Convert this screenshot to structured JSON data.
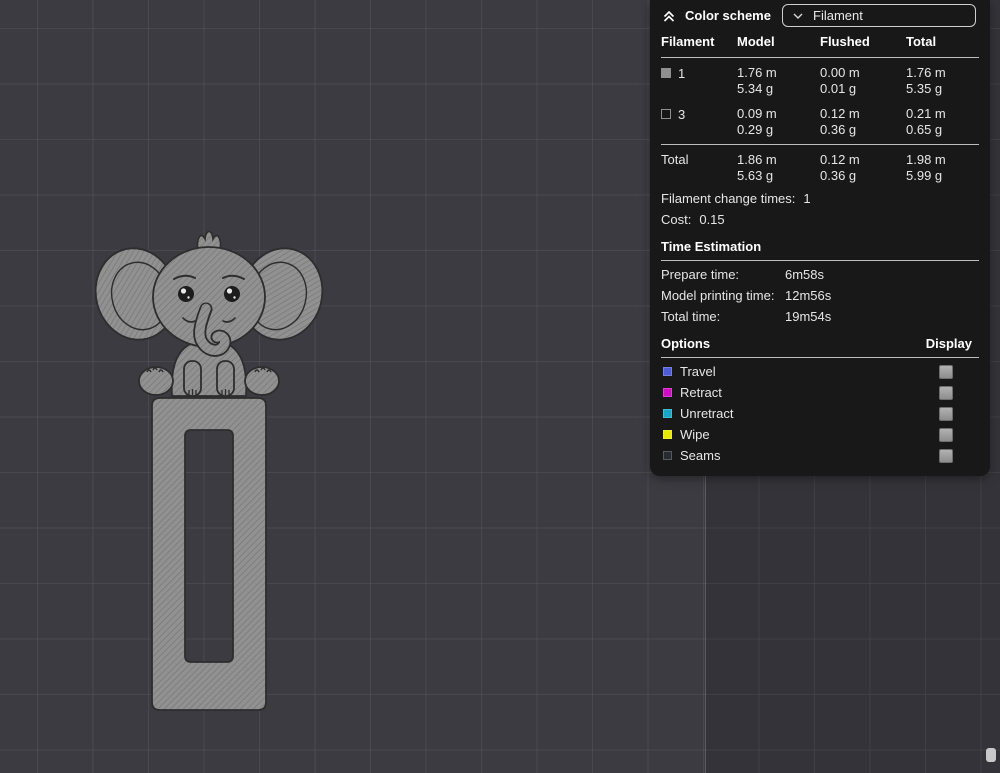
{
  "scene": {
    "bg": "#3b3b41",
    "plate_edge": "#5f5f66"
  },
  "model": {
    "name": "elephant bookmark",
    "fill": "#919191",
    "hatch": "#767676",
    "outline": "#2d2d2d"
  },
  "panel": {
    "title": "Color scheme",
    "dropdown": {
      "value": "Filament"
    },
    "table": {
      "headers": {
        "filament": "Filament",
        "model": "Model",
        "flushed": "Flushed",
        "total": "Total"
      },
      "rows": [
        {
          "id": "1",
          "color": "#8f8f8f",
          "model_len": "1.76 m",
          "model_wt": "5.34 g",
          "flushed_len": "0.00 m",
          "flushed_wt": "0.01 g",
          "total_len": "1.76 m",
          "total_wt": "5.35 g"
        },
        {
          "id": "3",
          "color": "#161616",
          "model_len": "0.09 m",
          "model_wt": "0.29 g",
          "flushed_len": "0.12 m",
          "flushed_wt": "0.36 g",
          "total_len": "0.21 m",
          "total_wt": "0.65 g"
        }
      ],
      "total": {
        "label": "Total",
        "model_len": "1.86 m",
        "model_wt": "5.63 g",
        "flushed_len": "0.12 m",
        "flushed_wt": "0.36 g",
        "total_len": "1.98 m",
        "total_wt": "5.99 g"
      }
    },
    "stats": [
      {
        "label": "Filament change times:",
        "value": "1"
      },
      {
        "label": "Cost:",
        "value": "0.15"
      }
    ],
    "time": {
      "title": "Time Estimation",
      "rows": [
        {
          "label": "Prepare time:",
          "value": "6m58s"
        },
        {
          "label": "Model printing time:",
          "value": "12m56s"
        },
        {
          "label": "Total time:",
          "value": "19m54s"
        }
      ]
    },
    "options": {
      "title": "Options",
      "display": "Display",
      "items": [
        {
          "label": "Travel",
          "color": "#4d5bd6"
        },
        {
          "label": "Retract",
          "color": "#ce0ec1"
        },
        {
          "label": "Unretract",
          "color": "#18a6c6"
        },
        {
          "label": "Wipe",
          "color": "#e8e800"
        },
        {
          "label": "Seams",
          "color": "#2a2a32"
        }
      ]
    }
  }
}
